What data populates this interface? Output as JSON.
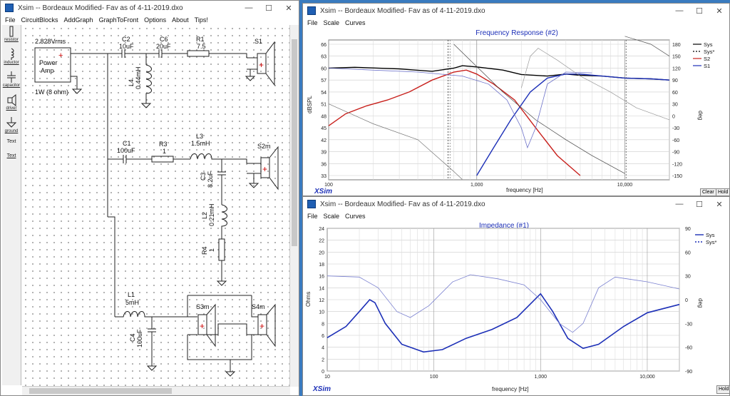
{
  "circuit_window": {
    "title": "Xsim -- Bordeaux Modified- Fav as of 4-11-2019.dxo",
    "menu": [
      "File",
      "CircuitBlocks",
      "AddGraph",
      "GraphToFront",
      "Options",
      "About",
      "Tips!"
    ],
    "palette": [
      "resistor",
      "inductor",
      "capacitor",
      "driver",
      "ground",
      "Text",
      "Text"
    ],
    "labels": {
      "source_v": "2.828Vrms",
      "source_name1": "Power",
      "source_name2": "Amp",
      "source_power": "1W (8 ohm)",
      "c2": "C2",
      "c2v": "10uF",
      "c6": "C6",
      "c6v": "20uF",
      "r1": "R1",
      "r1v": "7.5",
      "s1": "S1",
      "l4": "L4",
      "l4v": "0.44mH",
      "c1": "C1",
      "c1v": "100uF",
      "r3": "R3",
      "r3v": "1",
      "l3": "L3",
      "l3v": "1.5mH",
      "s2m": "S2m",
      "c3": "C3",
      "c3v": "8.2uF",
      "l2": "L2",
      "l2v": "0.21mH",
      "r4": "R4",
      "r4v": "1",
      "l1": "L1",
      "l1v": "5mH",
      "s3m": "S3m",
      "s4m": "S4m",
      "c4": "C4",
      "c4v": "100uF"
    }
  },
  "freq_window": {
    "title": "Xsim -- Bordeaux Modified- Fav as of 4-11-2019.dxo",
    "menu": [
      "File",
      "Scale",
      "Curves"
    ],
    "graph_title": "Frequency Response (#2)",
    "ylabel": "dBSPL",
    "y2label": "deg",
    "xlabel": "frequency [Hz]",
    "yticks": [
      "66",
      "63",
      "60",
      "57",
      "54",
      "51",
      "48",
      "45",
      "42",
      "39",
      "36",
      "33"
    ],
    "y2ticks": [
      "180",
      "150",
      "120",
      "90",
      "60",
      "30",
      "0",
      "-30",
      "-60",
      "-90",
      "-120",
      "-150"
    ],
    "xticks": [
      "100",
      "1,000",
      "10,000"
    ],
    "legend": [
      {
        "name": "Sys",
        "color": "#000000",
        "dash": false
      },
      {
        "name": "Sys*",
        "color": "#000000",
        "dash": true
      },
      {
        "name": "S2",
        "color": "#c8201c",
        "dash": false
      },
      {
        "name": "S1",
        "color": "#1c2fb7",
        "dash": false
      }
    ],
    "logo": "XSim",
    "buttons": [
      "Clear",
      "Hold"
    ]
  },
  "imp_window": {
    "title": "Xsim -- Bordeaux Modified- Fav as of 4-11-2019.dxo",
    "menu": [
      "File",
      "Scale",
      "Curves"
    ],
    "graph_title": "Impedance (#1)",
    "ylabel": "Ohms",
    "y2label": "deg",
    "xlabel": "frequency [Hz]",
    "yticks": [
      "24",
      "22",
      "20",
      "18",
      "16",
      "14",
      "12",
      "10",
      "8",
      "6",
      "4",
      "2",
      "0"
    ],
    "y2ticks": [
      "90",
      "60",
      "30",
      "0",
      "-30",
      "-60",
      "-90"
    ],
    "xticks": [
      "10",
      "100",
      "1,000",
      "10,000"
    ],
    "legend": [
      {
        "name": "Sys",
        "color": "#1c2fb7",
        "dash": false
      },
      {
        "name": "Sys*",
        "color": "#1c2fb7",
        "dash": true
      }
    ],
    "logo": "XSim",
    "buttons": [
      "Hold"
    ]
  },
  "colors": {
    "sys": "#000000",
    "s2": "#c8201c",
    "s1": "#1c2fb7",
    "title": "#1c2fb7"
  }
}
